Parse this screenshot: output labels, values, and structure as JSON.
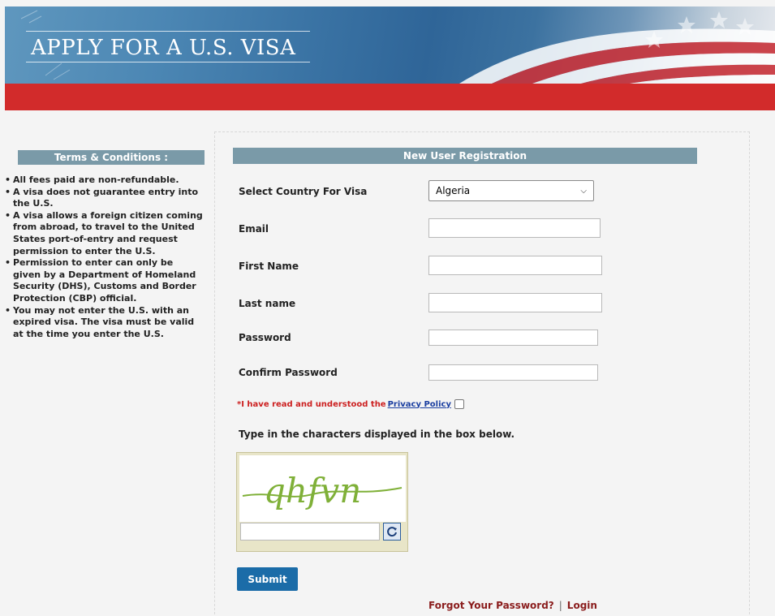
{
  "header": {
    "title": "APPLY FOR A U.S. VISA"
  },
  "terms": {
    "heading": "Terms & Conditions :",
    "items": [
      "All fees paid are non-refundable.",
      "A visa does not guarantee entry into the U.S.",
      "A visa allows a foreign citizen coming from abroad, to travel to the United States port-of-entry and request permission to enter the U.S.",
      "Permission to enter can only be given by a Department of Homeland Security (DHS), Customs and Border Protection (CBP) official.",
      "You may not enter the U.S. with an expired visa. The visa must be valid at the time you enter the U.S."
    ]
  },
  "form": {
    "heading": "New User Registration",
    "country_label": "Select Country For Visa",
    "country_value": "Algeria",
    "email_label": "Email",
    "first_name_label": "First Name",
    "last_name_label": "Last name",
    "password_label": "Password",
    "confirm_password_label": "Confirm Password",
    "privacy_prefix": "*I have read and understood the",
    "privacy_link": "Privacy Policy",
    "captcha_hint": "Type in the characters displayed in the box below.",
    "captcha_text": "qhfvn",
    "submit_label": "Submit",
    "forgot_password": "Forgot Your Password?",
    "separator": "|",
    "login": "Login"
  },
  "colors": {
    "header_blue": "#3a73a4",
    "red_bar": "#d22b2b",
    "section_head": "#7a9aa8",
    "submit_blue": "#1b6ca8",
    "link_red": "#8a1c1c"
  }
}
